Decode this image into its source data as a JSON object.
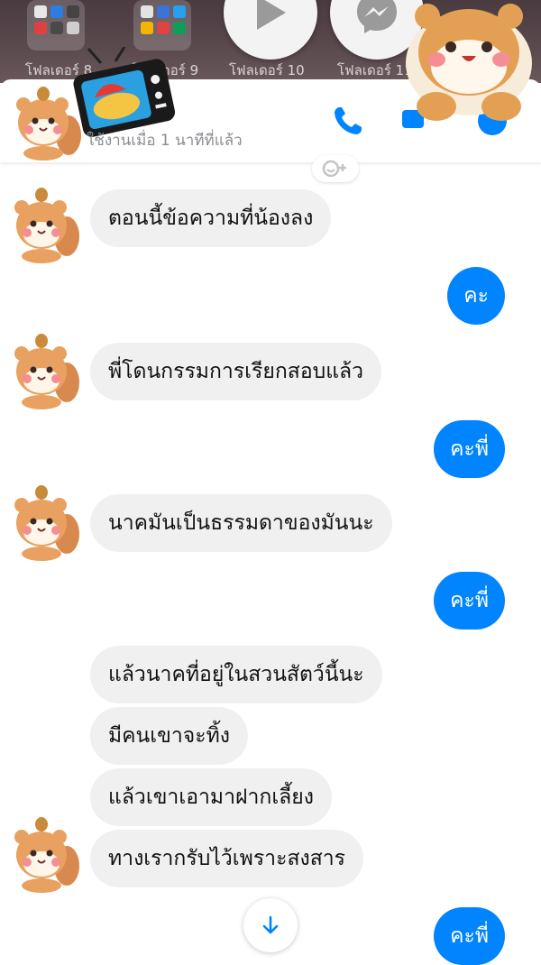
{
  "home_screen": {
    "folders": [
      "โฟลเดอร์ 8",
      "โฟลเดอร์ 9",
      "โฟลเดอร์ 10",
      "โฟลเดอร์ 11"
    ]
  },
  "chat_head_icons": [
    "play-icon",
    "messenger-icon"
  ],
  "header": {
    "status": "ใช้งานเมื่อ 1 นาทีที่แล้ว",
    "icons": [
      "phone-icon",
      "video-call-icon",
      "info-icon"
    ]
  },
  "messages": [
    {
      "side": "in",
      "text": "ตอนนี้ข้อความที่น้องลง"
    },
    {
      "side": "out",
      "text": "คะ"
    },
    {
      "side": "in",
      "text": "พี่โดนกรรมการเรียกสอบแล้ว"
    },
    {
      "side": "out",
      "text": "คะพี่"
    },
    {
      "side": "in",
      "text": "นาคมันเป็นธรรมดาของมันนะ"
    },
    {
      "side": "out",
      "text": "คะพี่"
    },
    {
      "side": "in",
      "text": "แล้วนาคที่อยู่ในสวนสัตว์นี้นะ"
    },
    {
      "side": "in",
      "text": "มีคนเขาจะทิ้ง"
    },
    {
      "side": "in",
      "text": "แล้วเขาเอามาฝากเลี้ยง"
    },
    {
      "side": "in",
      "text": "ทางเรากรับไว้เพราะสงสาร"
    },
    {
      "side": "out",
      "text": "คะพี่"
    }
  ],
  "colors": {
    "accent": "#0084ff",
    "incoming_bubble": "#f0f0f0",
    "status_text": "#8a8d91"
  },
  "scroll_button_icon": "arrow-down-icon"
}
